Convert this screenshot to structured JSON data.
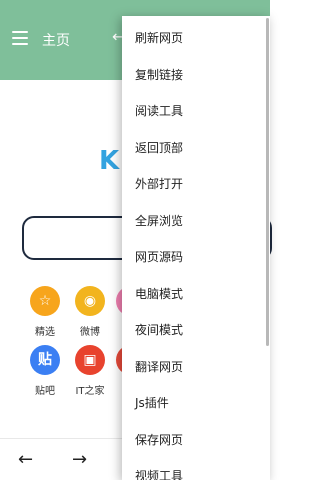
{
  "appbar": {
    "title": "主页",
    "back_icon": "arrow-left-icon"
  },
  "logo": {
    "text": "KI",
    "color": "#33a3e0"
  },
  "search": {
    "value": ""
  },
  "shortcuts": [
    {
      "label": "精选",
      "color": "#f7a51c",
      "glyph": "☆",
      "icon": "star-icon"
    },
    {
      "label": "微博",
      "color": "#f2b41e",
      "glyph": "◉",
      "icon": "weibo-icon"
    },
    {
      "label": "",
      "color": "#f07fb0",
      "glyph": "",
      "icon": "partial-icon"
    },
    {
      "label": "贴吧",
      "color": "#3b7ff3",
      "glyph": "贴",
      "icon": "tieba-icon"
    },
    {
      "label": "IT之家",
      "color": "#e8432e",
      "glyph": "▣",
      "icon": "ithome-icon"
    },
    {
      "label": "",
      "color": "#e84a3a",
      "glyph": "",
      "icon": "partial-icon"
    }
  ],
  "bottombar": {
    "back": "←",
    "forward": "→"
  },
  "menu": {
    "items": [
      "刷新网页",
      "复制链接",
      "阅读工具",
      "返回顶部",
      "外部打开",
      "全屏浏览",
      "网页源码",
      "电脑模式",
      "夜间模式",
      "翻译网页",
      "Js插件",
      "保存网页",
      "视频工具"
    ]
  },
  "colors": {
    "appbar": "#7fbf9a",
    "search_border": "#1e2a3e"
  }
}
